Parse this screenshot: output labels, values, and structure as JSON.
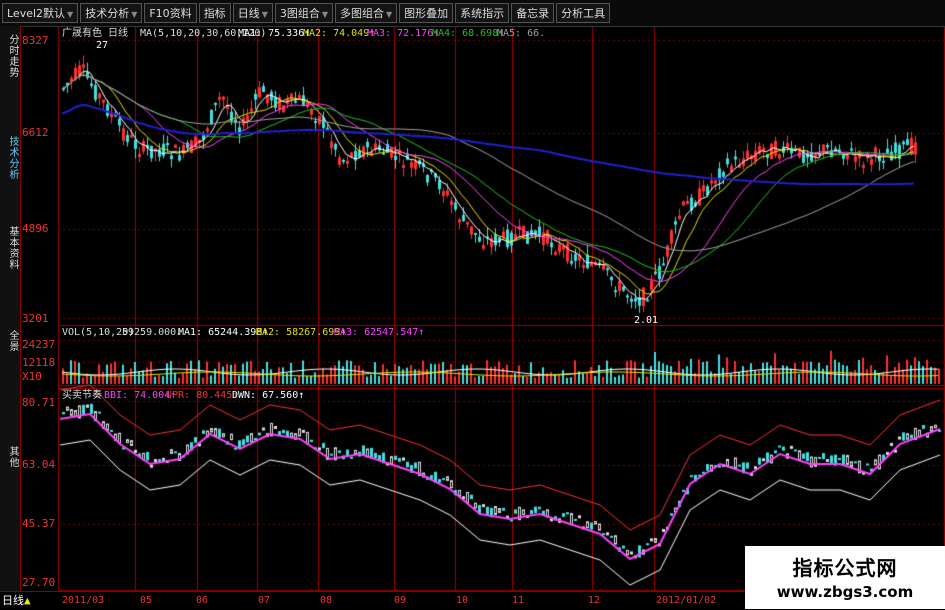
{
  "toolbar": {
    "items": [
      {
        "label": "Level2默认",
        "has_arrow": true
      },
      {
        "label": "技术分析",
        "has_arrow": true
      },
      {
        "label": "F10资料",
        "has_arrow": false
      },
      {
        "label": "指标",
        "has_arrow": false
      },
      {
        "label": "日线",
        "has_arrow": true
      },
      {
        "label": "3图组合",
        "has_arrow": true
      },
      {
        "label": "多图组合",
        "has_arrow": true
      },
      {
        "label": "图形叠加",
        "has_arrow": false
      },
      {
        "label": "系统指示",
        "has_arrow": false
      },
      {
        "label": "备忘录",
        "has_arrow": false
      },
      {
        "label": "分析工具",
        "has_arrow": false
      }
    ]
  },
  "side_tabs": [
    "分时走势",
    "技术分析",
    "基本资料",
    "全景"
  ],
  "price_panel": {
    "title": "广晟有色 日线",
    "ma_params": "MA(5,10,20,30,60,120)",
    "ma1": "MA1: 75.336↑",
    "ma2": "MA2: 74.049↑",
    "ma3": "MA3: 72.176↑",
    "ma4": "MA4: 68.698↑",
    "ma5": "MA5: 66.",
    "axis": [
      "8327",
      "6612",
      "4896",
      "3201"
    ],
    "marker_high": "27",
    "marker_low": "2.01"
  },
  "volume_panel": {
    "label": "VOL(5,10,20)",
    "value": "59259.000↓",
    "ma1": "MA1: 65244.398↑",
    "ma2": "MA2: 58267.699↑",
    "ma3": "MA3: 62547.547↑",
    "axis": [
      "24237",
      "12118",
      "X10"
    ]
  },
  "indicator_panel": {
    "name": "买卖节奏",
    "bbi": "BBI: 74.004↑",
    "upr": "UPR: 80.445↑",
    "dwn": "DWN: 67.560↑",
    "axis": [
      "80.71",
      "63.04",
      "45.37",
      "27.70"
    ],
    "side_label": "其他"
  },
  "time_axis": {
    "corner": "日线",
    "labels": [
      "2011/03",
      "05",
      "06",
      "07",
      "08",
      "09",
      "10",
      "11",
      "12",
      "2012/01/02"
    ]
  },
  "watermark": {
    "line1": "指标公式网",
    "line2": "www.zbgs3.com"
  },
  "colors": {
    "up": "#ff3030",
    "down": "#40e0e0",
    "ma_white": "#ffffff",
    "ma_yellow": "#e0e000",
    "ma_magenta": "#ff40ff",
    "ma_green": "#20c020",
    "ma_grey": "#a0a0a0",
    "ma_blue": "#2020d0",
    "frame": "#a00000"
  }
}
